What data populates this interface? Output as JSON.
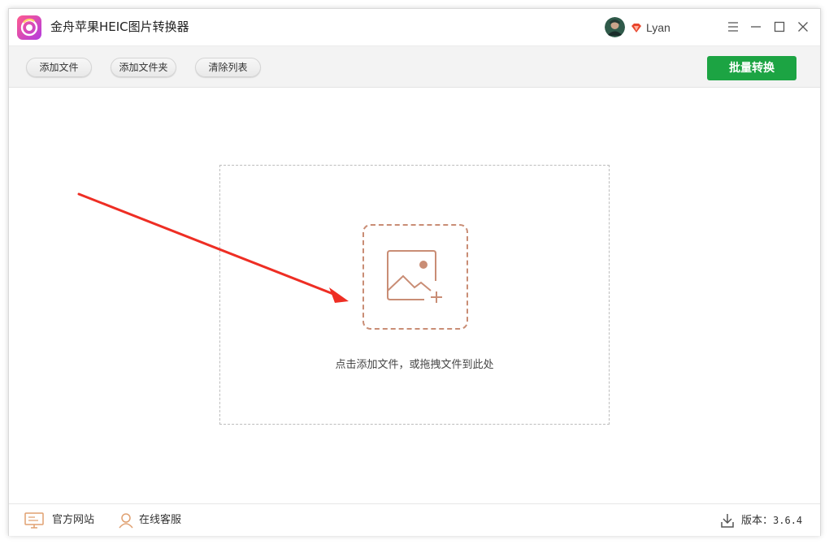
{
  "app": {
    "title": "金舟苹果HEIC图片转换器",
    "accent_color": "#1ca443",
    "logo_icon": "app-logo-icon"
  },
  "user": {
    "name": "Lyan",
    "vip_icon": "vip-diamond-icon"
  },
  "window_controls": [
    "menu-icon",
    "minimize-icon",
    "maximize-icon",
    "close-icon"
  ],
  "toolbar": {
    "add_file": "添加文件",
    "add_folder": "添加文件夹",
    "clear_list": "清除列表",
    "batch_convert": "批量转换"
  },
  "dropzone": {
    "hint": "点击添加文件，或拖拽文件到此处",
    "icon": "add-image-icon"
  },
  "footer": {
    "website": "官方网站",
    "support": "在线客服",
    "version_label": "版本：",
    "version": "3.6.4"
  }
}
